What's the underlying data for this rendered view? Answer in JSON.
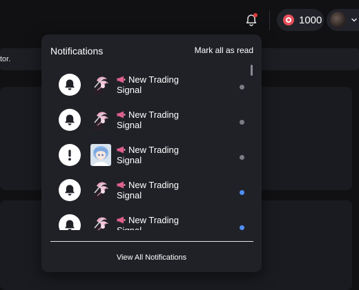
{
  "header": {
    "coins": "1000",
    "icons": {
      "notifications": "bell-icon",
      "coin": "coin-icon",
      "menu": "chevron-down-icon"
    },
    "colors": {
      "badge": "#e23b3b",
      "coin": "#e74e5a"
    }
  },
  "background": {
    "strip_text": "tor."
  },
  "notifications": {
    "title": "Notifications",
    "mark_all_label": "Mark all as read",
    "view_all_label": "View All Notifications",
    "colors": {
      "unread": "#4f8ff7",
      "read": "#7c7d84"
    },
    "items": [
      {
        "type_icon": "bell-icon",
        "thumb": "anime-character-pink",
        "title_line1": "New Trading",
        "title_line2": "Signal",
        "status": "read"
      },
      {
        "type_icon": "bell-icon",
        "thumb": "anime-character-pink",
        "title_line1": "New Trading",
        "title_line2": "Signal",
        "status": "read"
      },
      {
        "type_icon": "exclamation-icon",
        "thumb": "anime-character-blue-hair",
        "title_line1": "New Trading",
        "title_line2": "Signal",
        "status": "read"
      },
      {
        "type_icon": "bell-icon",
        "thumb": "anime-character-pink",
        "title_line1": "New Trading",
        "title_line2": "Signal",
        "status": "unread"
      },
      {
        "type_icon": "bell-icon",
        "thumb": "anime-character-pink",
        "title_line1": "New Trading",
        "title_line2": "Signal",
        "status": "unread"
      }
    ]
  }
}
